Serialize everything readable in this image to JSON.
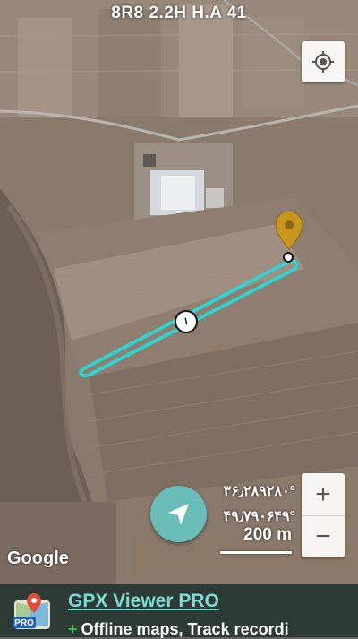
{
  "status_bar": {
    "text": "8R8  2.2H  H.A   41"
  },
  "map": {
    "attribution": "Google",
    "route_marker_label": "١",
    "colors": {
      "track": "#2fd3d0",
      "pin": "#c8961e",
      "nav_button": "#68bdb9"
    }
  },
  "overlay": {
    "latitude": "۳۶٫۲۸۹۲۸۰°",
    "longitude": "۴۹٫۷۹۰۶۴۹°",
    "scale_label": "200 m"
  },
  "controls": {
    "zoom_in": "+",
    "zoom_out": "−",
    "icons": [
      "locate-crosshair-icon",
      "navigation-arrow-icon",
      "location-pin-icon"
    ]
  },
  "ad": {
    "title": "GPX Viewer PRO",
    "subtitle": "Offline maps, Track recordi",
    "subtitle_prefix": "+",
    "icon_badge": "PRO"
  }
}
